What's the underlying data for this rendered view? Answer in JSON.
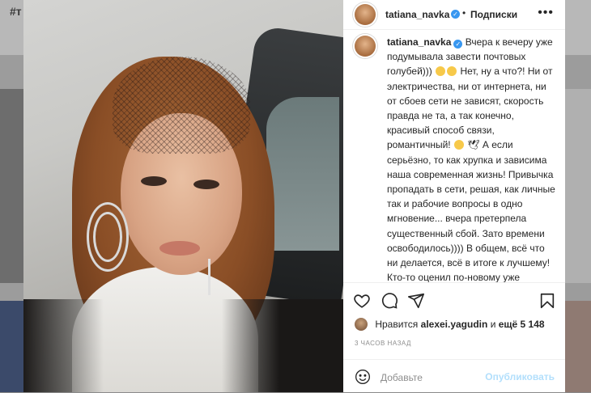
{
  "background": {
    "hashtag": "#т"
  },
  "post": {
    "username": "tatiana_navka",
    "follow_label": "Подписки",
    "more_icon": "more-horizontal-icon",
    "caption_username": "tatiana_navka",
    "caption_part1": "Вчера к вечеру уже подумывала завести почтовых голубей)))",
    "caption_part2": "Нет, ну а что?! Ни от электричества, ни от интернета, ни от сбоев сети не зависят, скорость правда не та, а так конечно, красивый способ связи, романтичный!",
    "caption_part3": "🕊 А если серьёзно, то как хрупка и зависима наша современная жизнь! Привычка пропадать в сети, решая, как личные так и рабочие вопросы в одно мгновение... вчера претерпела существенный сбой. Зато времени освободилось)))) В общем, всё что ни делается, всё в итоге к лучшему! Кто-то оценил по-новому уже привычные возможности, которые являются привычной повседневной частью нашей жизни, а кто-то осознал свою зависимость от",
    "likes_prefix": "Нравится",
    "likes_user": "alexei.yagudin",
    "likes_and": "и",
    "likes_more": "ещё 5 148",
    "time_ago": "3 ЧАСОВ НАЗАД",
    "comment_placeholder": "Добавьте",
    "publish_label": "Опубликовать"
  },
  "icons": [
    "heart-icon",
    "comment-icon",
    "share-icon",
    "bookmark-icon",
    "smile-icon",
    "verified-icon"
  ],
  "colors": {
    "link_disabled": "#b2dffc",
    "verified": "#3897f0",
    "text": "#262626",
    "muted": "#8e8e8e"
  }
}
